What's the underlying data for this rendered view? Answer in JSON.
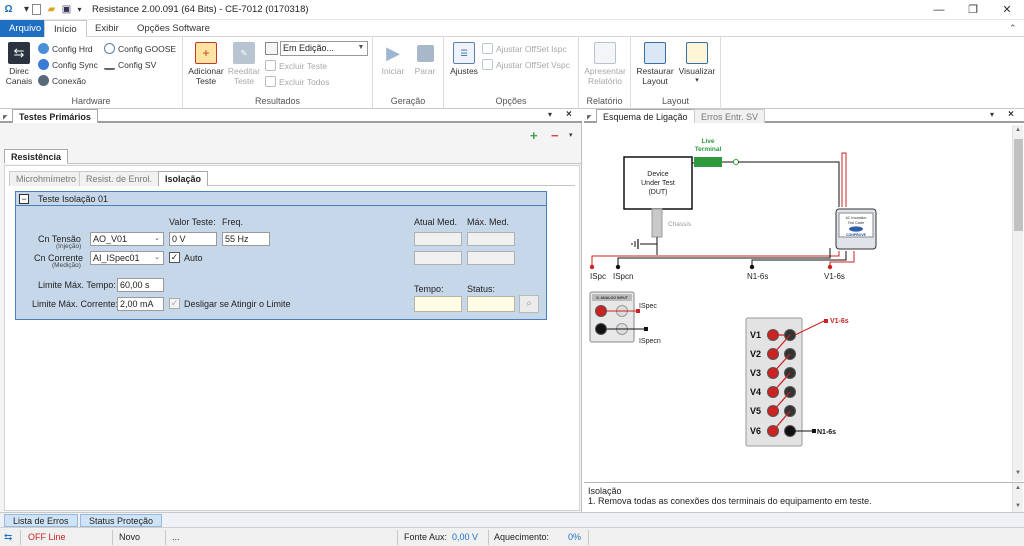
{
  "window": {
    "title": "Resistance 2.00.091 (64 Bits) - CE-7012 (0170318)",
    "minimize": "—",
    "maximize": "❐",
    "close": "✕"
  },
  "ribbon_tabs": [
    "Arquivo",
    "Início",
    "Exibir",
    "Opções Software"
  ],
  "ribbon": {
    "hardware": {
      "group": "Hardware",
      "direc_canais": "Direc\nCanais",
      "config_hrd": "Config Hrd",
      "config_goose": "Config GOOSE",
      "config_sync": "Config Sync",
      "config_sv": "Config SV",
      "conexao": "Conexão"
    },
    "resultados": {
      "group": "Resultados",
      "adicionar": "Adicionar\nTeste",
      "reeditar": "Reeditar\nTeste",
      "status_select": "Em Edição...",
      "excluir_teste": "Excluir Teste",
      "excluir_todos": "Excluir Todos"
    },
    "geracao": {
      "group": "Geração",
      "iniciar": "Iniciar",
      "parar": "Parar"
    },
    "opcoes": {
      "group": "Opções",
      "ajustes": "Ajustes",
      "ajustar_ispc": "Ajustar OffSet Ispc",
      "ajustar_vspc": "Ajustar OffSet Vspc"
    },
    "relatorio": {
      "group": "Relatório",
      "apresentar": "Apresentar\nRelatório"
    },
    "layout": {
      "group": "Layout",
      "restaurar": "Restaurar\nLayout",
      "visualizar": "Visualizar"
    }
  },
  "left_panel": {
    "tab": "Testes Primários",
    "section_tab": "Resistência",
    "subtabs": [
      "Microhmímetro",
      "Resist. de Enrol.",
      "Isolação"
    ],
    "test": {
      "title": "Teste Isolação 01",
      "collapse": "−",
      "col_valor_teste": "Valor Teste:",
      "col_freq": "Freq.",
      "col_atual_med": "Atual Med.",
      "col_max_med": "Máx. Med.",
      "cn_tensao": "Cn Tensão",
      "cn_tensao_sub": "(Injeção)",
      "cn_tensao_value": "AO_V01",
      "valor_teste_value": "0 V",
      "freq_value": "55 Hz",
      "cn_corrente": "Cn Corrente",
      "cn_corrente_sub": "(Medição)",
      "cn_corrente_value": "AI_ISpec01",
      "auto_label": "Auto",
      "auto_checked": true,
      "limite_tempo_label": "Limite Máx. Tempo:",
      "limite_tempo_value": "60,00 s",
      "limite_corrente_label": "Limite Máx. Corrente:",
      "limite_corrente_value": "2,00 mA",
      "desligar_label": "Desligar se Atingir o Limite",
      "tempo_label": "Tempo:",
      "status_label": "Status:"
    }
  },
  "right_panel": {
    "tabs": [
      "Esquema de Ligação",
      "Erros Entr. SV"
    ],
    "diagram": {
      "dut_line1": "Device",
      "dut_line2": "Under Test",
      "dut_line3": "(DUT)",
      "live_terminal_1": "Live",
      "live_terminal_2": "Terminal",
      "chassis": "Chassis",
      "ispc": "ISpc",
      "ispcn": "ISpcn",
      "n16s": "N1-6s",
      "v16s": "V1-6s",
      "cable_1": "AC Insulation",
      "cable_2": "Test Cable",
      "cable_brand": "CONPROVE",
      "analog_input": "S. ANALOG INPUT",
      "spec_label": "ISpec",
      "specn_label": "ISpecn",
      "v_outputs": [
        "V1",
        "V2",
        "V3",
        "V4",
        "V5",
        "V6"
      ],
      "v1_tag": "V1-6s",
      "n1_tag": "N1-6s"
    },
    "note_title": "Isolação",
    "note_text": "1. Remova todas as conexões dos terminais do equipamento em teste."
  },
  "bottom_tabs": [
    "Lista de Erros",
    "Status Proteção"
  ],
  "statusbar": {
    "offline": "OFF Line",
    "mode": "Novo",
    "ellipsis": "...",
    "fonte_aux_label": "Fonte Aux:",
    "fonte_aux_value": "0,00 V",
    "aquecimento_label": "Aquecimento:",
    "aquecimento_value": "0%"
  },
  "colors": {
    "accent": "#1e6ec2",
    "group_bg": "#c7d7ea",
    "wire_red": "#cc2222",
    "live_green": "#2e9a3e"
  }
}
